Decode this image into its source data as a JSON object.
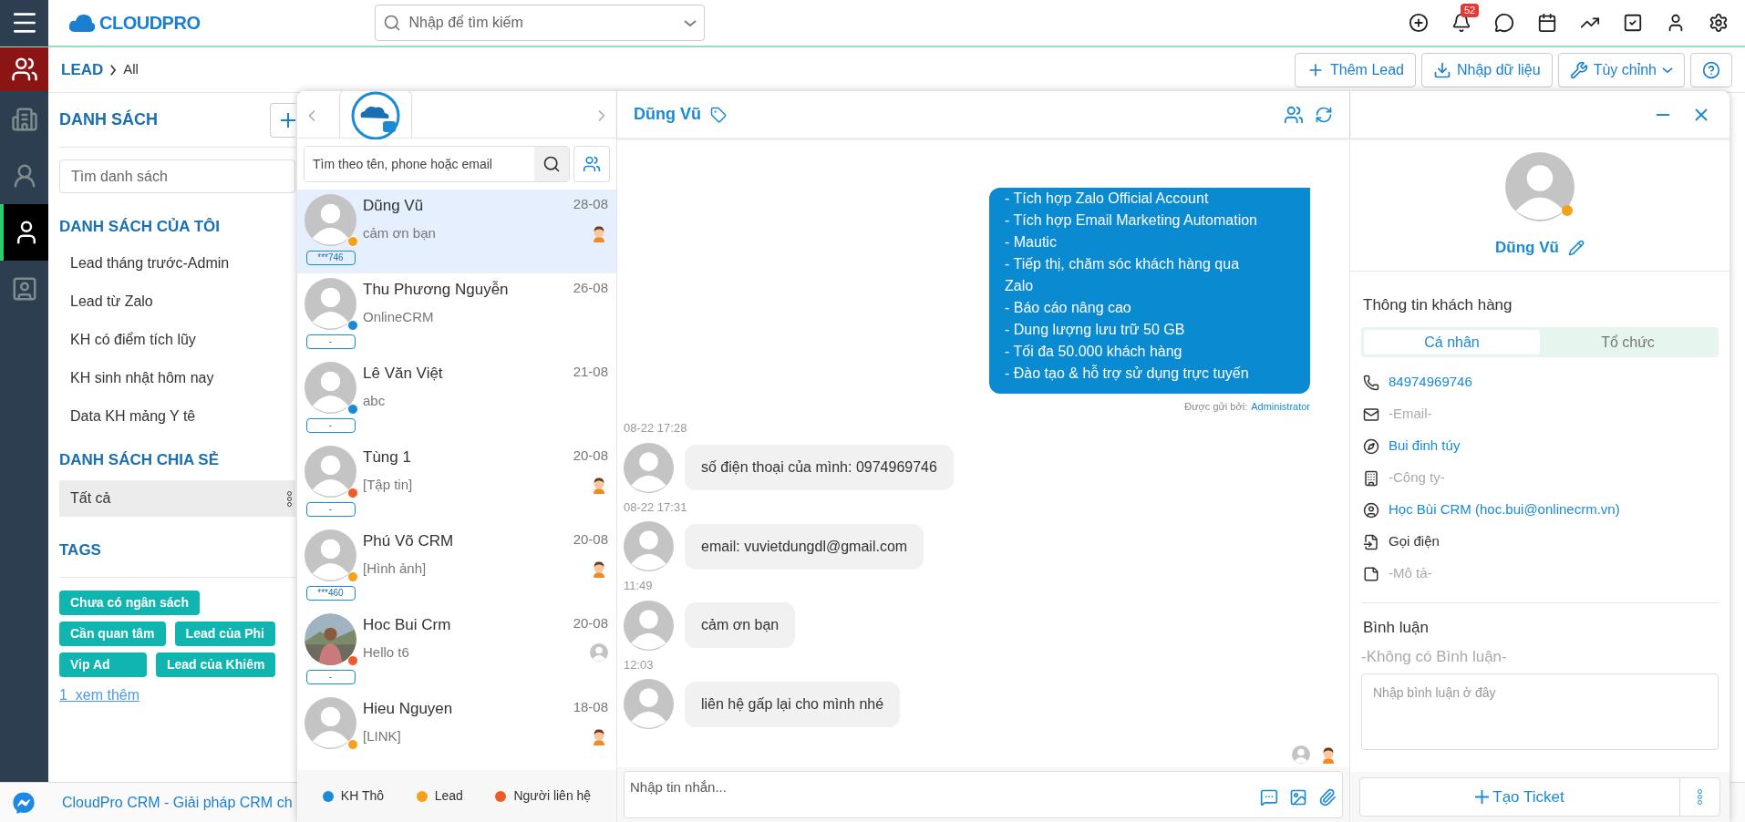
{
  "topbar": {
    "logo": "CLOUDPRO",
    "search_placeholder": "Nhập để tìm kiếm",
    "notification_count": "52"
  },
  "rail": [
    {
      "kind": "building",
      "selected": false
    },
    {
      "kind": "staff",
      "selected": false
    },
    {
      "kind": "person",
      "selected": true
    },
    {
      "kind": "card",
      "selected": false
    }
  ],
  "breadcrumb": {
    "module": "LEAD",
    "current": "All"
  },
  "actions": [
    {
      "kind": "add",
      "label": "Thêm Lead"
    },
    {
      "kind": "import",
      "label": "Nhập dữ liệu"
    },
    {
      "kind": "customize",
      "label": "Tùy chỉnh"
    },
    {
      "kind": "help"
    }
  ],
  "lists": {
    "title": "DANH SÁCH",
    "search_placeholder": "Tìm danh sách",
    "my_title": "DANH SÁCH CỦA TÔI",
    "my_items": [
      "Lead tháng trước-Admin",
      "Lead từ Zalo",
      "KH có điểm tích lũy",
      "KH sinh nhật hôm nay",
      "Data KH mảng Y tê"
    ],
    "shared_title": "DANH SÁCH CHIA SẺ",
    "shared_items": [
      {
        "label": "Tất cả",
        "selected": true
      }
    ],
    "tags_title": "TAGS",
    "tags": [
      "Chưa có ngân sách",
      "Cần quan tâm",
      "Lead của Phi",
      "Vip Ad",
      "Lead của Khiêm"
    ],
    "more": "1  xem thêm"
  },
  "footer": {
    "text": "CloudPro CRM - Giải pháp CRM ch"
  },
  "chat": {
    "search_placeholder": "Tìm theo tên, phone hoặc email",
    "conversations": [
      {
        "kind": "default",
        "name": "Dũng Vũ",
        "date": "28-08",
        "preview": "cảm ơn bạn",
        "badge": "***746",
        "color": "#f5a11c",
        "agent": {
          "kind": "cartoon"
        },
        "selected": true
      },
      {
        "kind": "default",
        "name": "Thu Phương Nguyễn",
        "date": "26-08",
        "preview": "OnlineCRM",
        "badge": "-",
        "color": "#1a8ad4",
        "selected": false
      },
      {
        "kind": "default",
        "name": "Lê Văn Việt",
        "date": "21-08",
        "preview": "abc",
        "badge": "-",
        "color": "#1a8ad4",
        "selected": false
      },
      {
        "kind": "default",
        "name": "Tùng 1",
        "date": "20-08",
        "preview": "[Tập tin]",
        "badge": "-",
        "color": "#f05a28",
        "agent": {
          "kind": "cartoon"
        },
        "selected": false
      },
      {
        "kind": "default",
        "name": "Phú Võ CRM",
        "date": "20-08",
        "preview": "[Hình ảnh]",
        "badge": "***460",
        "color": "#f5a11c",
        "agent": {
          "kind": "cartoon"
        },
        "selected": false
      },
      {
        "name": "Hoc Bui Crm",
        "date": "20-08",
        "preview": "Hello t6",
        "badge": "-",
        "color": "#f05a28",
        "selected": false
      },
      {
        "kind": "default",
        "name": "Hieu Nguyen",
        "date": "18-08",
        "preview": "[LINK]",
        "color": "#f5a11c",
        "agent": {
          "kind": "cartoon"
        },
        "selected": false
      }
    ],
    "legend": [
      {
        "label": "KH Thô",
        "color": "#1a8ad4"
      },
      {
        "label": "Lead",
        "color": "#f5a11c"
      },
      {
        "label": "Người liên hệ",
        "color": "#f05a28"
      }
    ],
    "header": {
      "name": "Dũng Vũ"
    },
    "outgoing": {
      "lines": [
        "- Tích hợp Zalo Official Account",
        "- Tích hợp Email Marketing Automation",
        "- Mautic",
        "- Tiếp thị, chăm sóc khách hàng qua",
        "Zalo",
        "- Báo cáo nâng cao",
        "- Dung lượng lưu trữ 50 GB",
        "- Tối đa 50.000 khách hàng",
        "- Đào tạo & hỗ trợ sử dụng trực tuyến"
      ],
      "sent_by_label": "Được gửi bởi:",
      "sent_by": "Administrator"
    },
    "incoming": [
      {
        "time": "08-22 17:28",
        "text": "số điện thoại của mình: 0974969746"
      },
      {
        "time": "08-22 17:31",
        "text": "email: vuvietdungdl@gmail.com"
      },
      {
        "time": "11:49",
        "text": "cảm ơn bạn"
      },
      {
        "time": "12:03",
        "text": "liên hệ gấp lại cho mình nhé"
      }
    ],
    "composer_placeholder": "Nhập tin nhắn..."
  },
  "customer": {
    "name": "Dũng Vũ",
    "color": "#f5a11c",
    "section_title": "Thông tin khách hàng",
    "tabs": [
      {
        "label": "Cá nhân",
        "selected": true
      },
      {
        "label": "Tổ chức",
        "selected": false
      }
    ],
    "fields": [
      {
        "kind": "phone",
        "value": "84974969746",
        "empty": false,
        "link": true
      },
      {
        "kind": "email",
        "value": "-Email-",
        "empty": true,
        "link": false
      },
      {
        "kind": "address",
        "value": "Bui đinh túy",
        "empty": false,
        "link": true
      },
      {
        "kind": "company",
        "value": "-Công ty-",
        "empty": true,
        "link": false
      },
      {
        "kind": "owner",
        "value": "Học Bùi CRM (hoc.bui@onlinecrm.vn)",
        "empty": false,
        "link": true
      },
      {
        "kind": "source",
        "value": "Gọi điện",
        "empty": false,
        "link": false
      },
      {
        "kind": "note",
        "value": "-Mô tả-",
        "empty": true,
        "link": false
      }
    ],
    "comments_title": "Bình luận",
    "no_comments": "-Không có Bình luận-",
    "comment_placeholder": "Nhập bình luận ở đây",
    "ticket_button": "Tạo Ticket"
  }
}
